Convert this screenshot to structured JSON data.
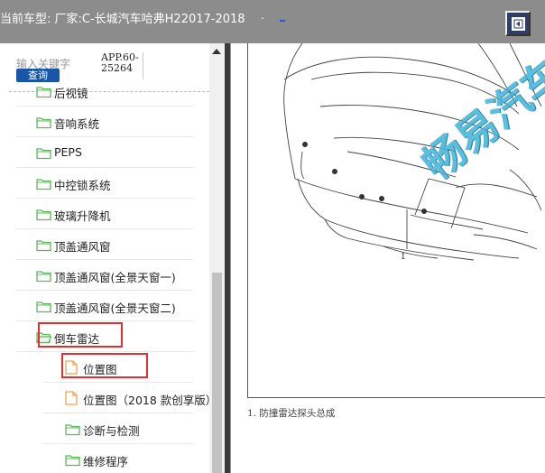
{
  "header": {
    "text": "当前车型:  厂家:C-长城汽车哈弗H22017-2018",
    "dot": ".",
    "dash": "_",
    "button_icon": "restore-icon"
  },
  "search": {
    "placeholder": "输入关键字",
    "app_code": "APP.60-25264",
    "query_label": "查询"
  },
  "tree": [
    {
      "label": "后视镜",
      "level": 1,
      "type": "folder"
    },
    {
      "label": "音响系统",
      "level": 1,
      "type": "folder"
    },
    {
      "label": "PEPS",
      "level": 1,
      "type": "folder"
    },
    {
      "label": "中控锁系统",
      "level": 1,
      "type": "folder"
    },
    {
      "label": "玻璃升降机",
      "level": 1,
      "type": "folder"
    },
    {
      "label": "顶盖通风窗",
      "level": 1,
      "type": "folder"
    },
    {
      "label": "顶盖通风窗(全景天窗一)",
      "level": 1,
      "type": "folder"
    },
    {
      "label": "顶盖通风窗(全景天窗二)",
      "level": 1,
      "type": "folder"
    },
    {
      "label": "倒车雷达",
      "level": 1,
      "type": "folder-open",
      "highlighted": true
    },
    {
      "label": "位置图",
      "level": 2,
      "type": "document",
      "highlighted": true
    },
    {
      "label": "位置图（2018 款创享版）",
      "level": 2,
      "type": "document"
    },
    {
      "label": "诊断与检测",
      "level": 2,
      "type": "folder"
    },
    {
      "label": "维修程序",
      "level": 2,
      "type": "folder"
    }
  ],
  "figure": {
    "callout_label": "1",
    "caption": "1.   防撞雷达探头总成",
    "watermark": "畅易汽车"
  },
  "colors": {
    "header_bg": "#8c8c8c",
    "folder": "#5cb85c",
    "document": "#f0a050",
    "highlight": "#e03030",
    "query_button": "#1a56a8",
    "watermark": "#3fb3d9"
  }
}
